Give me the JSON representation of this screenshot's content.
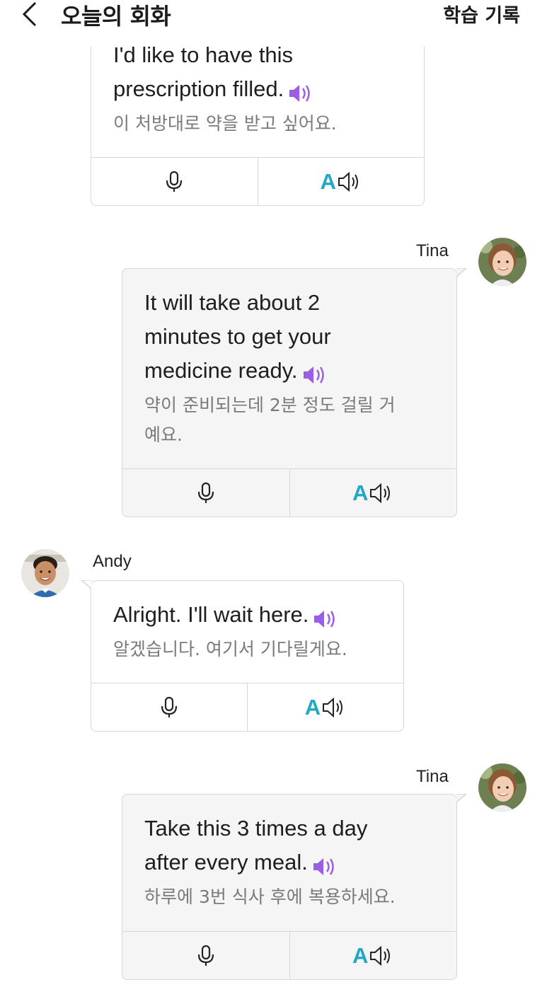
{
  "header": {
    "title": "오늘의 회화",
    "history_label": "학습 기록"
  },
  "messages": [
    {
      "en_line1": "I'd like to have this",
      "en_line2": "prescription filled.",
      "ko": "이 처방대로 약을 받고 싶어요."
    },
    {
      "speaker": "Tina",
      "en_line1": "It will take about 2",
      "en_line2": "minutes to get your",
      "en_line3": "medicine ready.",
      "ko_line1": "약이 준비되는데 2분 정도 걸릴 거",
      "ko_line2": "예요."
    },
    {
      "speaker": "Andy",
      "en_line1": "Alright. I'll wait here.",
      "ko": "알겠습니다. 여기서 기다릴게요."
    },
    {
      "speaker": "Tina",
      "en_line1": "Take this 3 times a day",
      "en_line2": "after every meal.",
      "ko": "하루에 3번 식사 후에 복용하세요."
    }
  ],
  "action_letter": "A",
  "icons": {
    "back": "chevron-left-icon",
    "play": "speaker-icon",
    "record": "microphone-icon",
    "listen": "speaker-outline-icon"
  },
  "colors": {
    "accent_purple": "#9b5de5",
    "accent_teal": "#22a8c4"
  }
}
